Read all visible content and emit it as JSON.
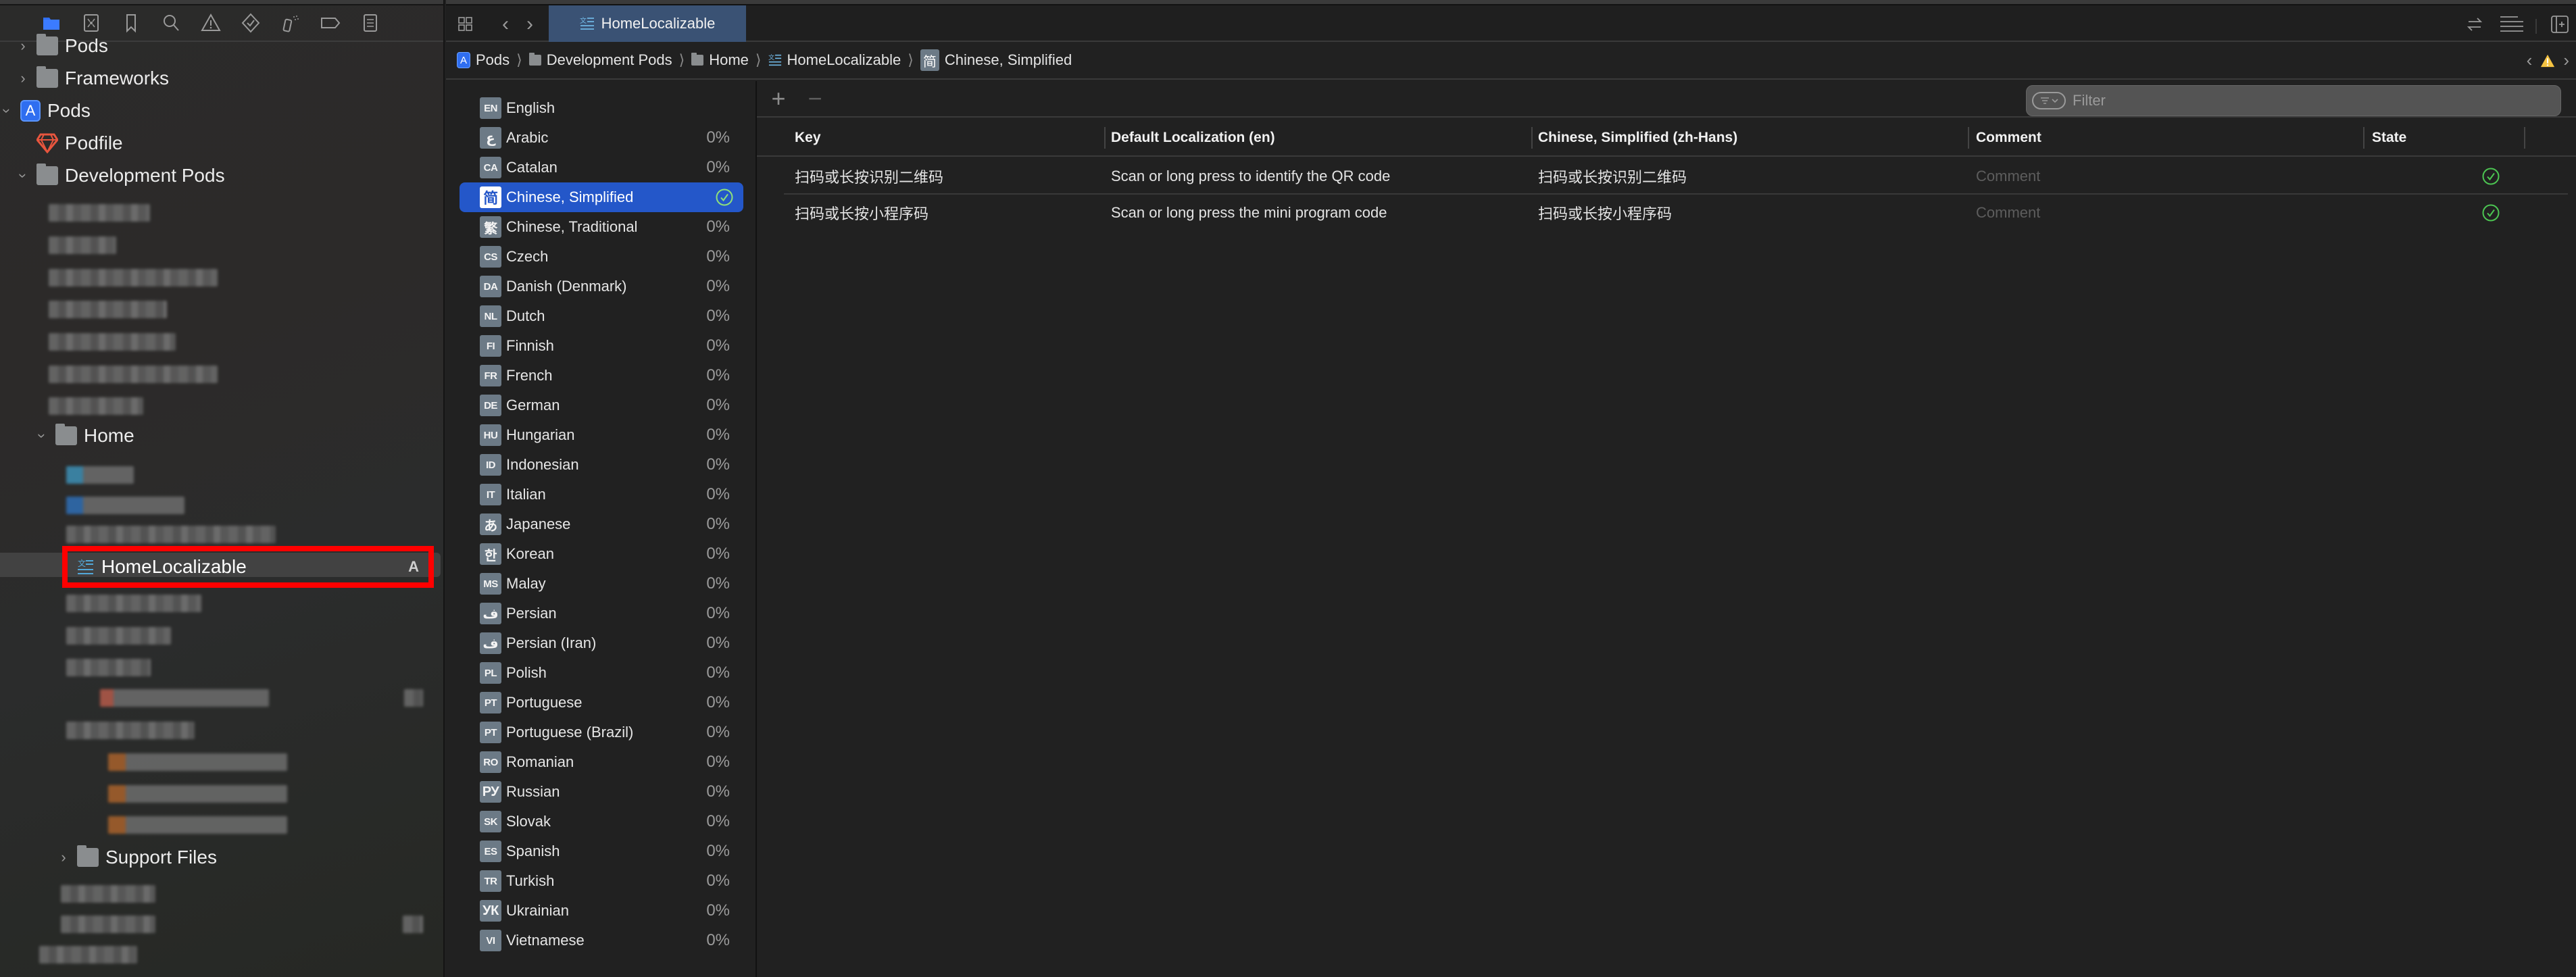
{
  "navigator": {
    "toolbar": [
      {
        "name": "project-navigator",
        "icon": "folder-icon",
        "active": true
      },
      {
        "name": "source-control-navigator",
        "icon": "source-control-icon"
      },
      {
        "name": "bookmark-navigator",
        "icon": "bookmark-icon"
      },
      {
        "name": "find-navigator",
        "icon": "search-icon"
      },
      {
        "name": "issue-navigator",
        "icon": "warning-icon"
      },
      {
        "name": "test-navigator",
        "icon": "test-diamond-icon"
      },
      {
        "name": "debug-navigator",
        "icon": "spray-icon"
      },
      {
        "name": "breakpoint-navigator",
        "icon": "breakpoint-tag-icon"
      },
      {
        "name": "report-navigator",
        "icon": "report-list-icon"
      }
    ],
    "tree": {
      "pods_folder": "Pods",
      "frameworks": "Frameworks",
      "pods_project": "Pods",
      "podfile": "Podfile",
      "development_pods": "Development Pods",
      "home": "Home",
      "selected_file": "HomeLocalizable",
      "selected_file_badge": "A",
      "support_files": "Support Files"
    }
  },
  "editor": {
    "tab": {
      "label": "HomeLocalizable"
    },
    "breadcrumb": [
      {
        "label": "Pods",
        "icon": "app-store-icon"
      },
      {
        "label": "Development Pods",
        "icon": "folder-icon"
      },
      {
        "label": "Home",
        "icon": "folder-icon"
      },
      {
        "label": "HomeLocalizable",
        "icon": "localizable-strings-icon"
      },
      {
        "label": "Chinese, Simplified",
        "icon": "简"
      }
    ],
    "languages": [
      {
        "code": "EN",
        "name": "English",
        "pct": ""
      },
      {
        "code": "ع",
        "name": "Arabic",
        "pct": "0%"
      },
      {
        "code": "CA",
        "name": "Catalan",
        "pct": "0%"
      },
      {
        "code": "简",
        "name": "Chinese, Simplified",
        "pct": "",
        "selected": true,
        "complete": true
      },
      {
        "code": "繁",
        "name": "Chinese, Traditional",
        "pct": "0%"
      },
      {
        "code": "CS",
        "name": "Czech",
        "pct": "0%"
      },
      {
        "code": "DA",
        "name": "Danish (Denmark)",
        "pct": "0%"
      },
      {
        "code": "NL",
        "name": "Dutch",
        "pct": "0%"
      },
      {
        "code": "FI",
        "name": "Finnish",
        "pct": "0%"
      },
      {
        "code": "FR",
        "name": "French",
        "pct": "0%"
      },
      {
        "code": "DE",
        "name": "German",
        "pct": "0%"
      },
      {
        "code": "HU",
        "name": "Hungarian",
        "pct": "0%"
      },
      {
        "code": "ID",
        "name": "Indonesian",
        "pct": "0%"
      },
      {
        "code": "IT",
        "name": "Italian",
        "pct": "0%"
      },
      {
        "code": "あ",
        "name": "Japanese",
        "pct": "0%"
      },
      {
        "code": "한",
        "name": "Korean",
        "pct": "0%"
      },
      {
        "code": "MS",
        "name": "Malay",
        "pct": "0%"
      },
      {
        "code": "ف",
        "name": "Persian",
        "pct": "0%"
      },
      {
        "code": "ف",
        "name": "Persian (Iran)",
        "pct": "0%"
      },
      {
        "code": "PL",
        "name": "Polish",
        "pct": "0%"
      },
      {
        "code": "PT",
        "name": "Portuguese",
        "pct": "0%"
      },
      {
        "code": "PT",
        "name": "Portuguese (Brazil)",
        "pct": "0%"
      },
      {
        "code": "RO",
        "name": "Romanian",
        "pct": "0%"
      },
      {
        "code": "РУ",
        "name": "Russian",
        "pct": "0%"
      },
      {
        "code": "SK",
        "name": "Slovak",
        "pct": "0%"
      },
      {
        "code": "ES",
        "name": "Spanish",
        "pct": "0%"
      },
      {
        "code": "TR",
        "name": "Turkish",
        "pct": "0%"
      },
      {
        "code": "УК",
        "name": "Ukrainian",
        "pct": "0%"
      },
      {
        "code": "VI",
        "name": "Vietnamese",
        "pct": "0%"
      }
    ],
    "strings_toolbar": {
      "add_label": "+",
      "remove_label": "−",
      "filter_placeholder": "Filter",
      "filter_value": ""
    },
    "table": {
      "columns": [
        "Key",
        "Default Localization (en)",
        "Chinese, Simplified (zh-Hans)",
        "Comment",
        "State"
      ],
      "rows": [
        {
          "key": "扫码或长按识别二维码",
          "default": "Scan or long press to identify the QR code",
          "translation": "扫码或长按识别二维码",
          "comment": "Comment",
          "state": "translated"
        },
        {
          "key": "扫码或长按小程序码",
          "default": "Scan or long press the mini program code",
          "translation": "扫码或长按小程序码",
          "comment": "Comment",
          "state": "translated"
        }
      ]
    }
  },
  "colors": {
    "accent": "#2457c9",
    "tab_active": "#3a5274",
    "state_ok": "#4cc552",
    "warning": "#f5c342",
    "highlight_box": "#ff0000"
  }
}
